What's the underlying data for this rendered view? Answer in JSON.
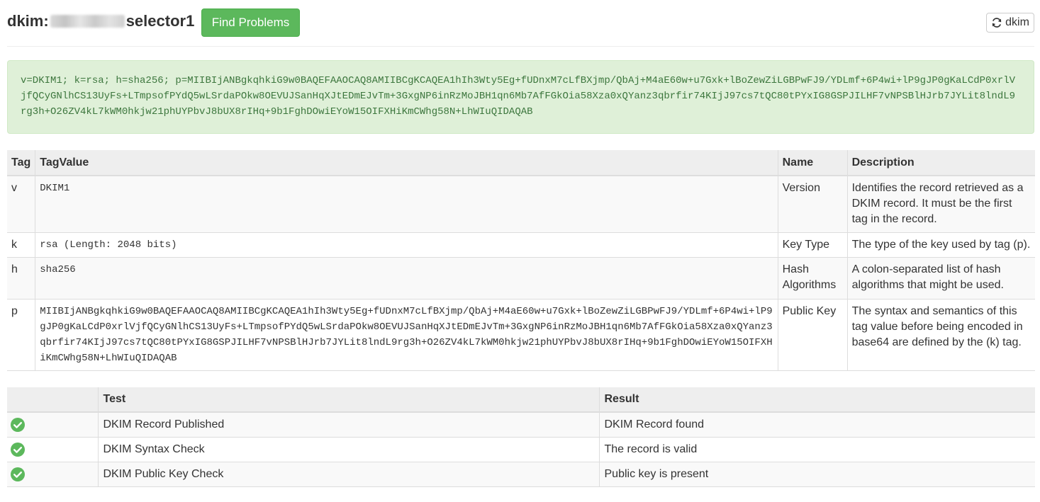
{
  "header": {
    "title_prefix": "dkim:",
    "title_suffix": "selector1",
    "find_button": "Find Problems",
    "refresh_button": "dkim"
  },
  "record": "v=DKIM1; k=rsa; h=sha256; p=MIIBIjANBgkqhkiG9w0BAQEFAAOCAQ8AMIIBCgKCAQEA1hIh3Wty5Eg+fUDnxM7cLfBXjmp/QbAj+M4aE60w+u7Gxk+lBoZewZiLGBPwFJ9/YDLmf+6P4wi+lP9gJP0gKaLCdP0xrlVjfQCyGNlhCS13UyFs+LTmpsofPYdQ5wLSrdaPOkw8OEVUJSanHqXJtEDmEJvTm+3GxgNP6inRzMoJBH1qn6Mb7AfFGkOia58Xza0xQYanz3qbrfir74KIjJ97cs7tQC80tPYxIG8GSPJILHF7vNPSBlHJrb7JYLit8lndL9rg3h+O26ZV4kL7kWM0hkjw21phUYPbvJ8bUX8rIHq+9b1FghDOwiEYoW15OIFXHiKmCWhg58N+LhWIuQIDAQAB",
  "tag_table": {
    "headers": {
      "tag": "Tag",
      "value": "TagValue",
      "name": "Name",
      "description": "Description"
    },
    "rows": [
      {
        "tag": "v",
        "value": "DKIM1",
        "name": "Version",
        "description": "Identifies the record retrieved as a DKIM record. It must be the first tag in the record."
      },
      {
        "tag": "k",
        "value": "rsa (Length: 2048 bits)",
        "name": "Key Type",
        "description": "The type of the key used by tag (p)."
      },
      {
        "tag": "h",
        "value": "sha256",
        "name": "Hash Algorithms",
        "description": "A colon-separated list of hash algorithms that might be used."
      },
      {
        "tag": "p",
        "value": "MIIBIjANBgkqhkiG9w0BAQEFAAOCAQ8AMIIBCgKCAQEA1hIh3Wty5Eg+fUDnxM7cLfBXjmp/QbAj+M4aE60w+u7Gxk+lBoZewZiLGBPwFJ9/YDLmf+6P4wi+lP9gJP0gKaLCdP0xrlVjfQCyGNlhCS13UyFs+LTmpsofPYdQ5wLSrdaPOkw8OEVUJSanHqXJtEDmEJvTm+3GxgNP6inRzMoJBH1qn6Mb7AfFGkOia58Xza0xQYanz3qbrfir74KIjJ97cs7tQC80tPYxIG8GSPJILHF7vNPSBlHJrb7JYLit8lndL9rg3h+O26ZV4kL7kWM0hkjw21phUYPbvJ8bUX8rIHq+9b1FghDOwiEYoW15OIFXHiKmCWhg58N+LhWIuQIDAQAB",
        "name": "Public Key",
        "description": "The syntax and semantics of this tag value before being encoded in base64 are defined by the (k) tag."
      }
    ]
  },
  "test_table": {
    "headers": {
      "status": "",
      "test": "Test",
      "result": "Result"
    },
    "rows": [
      {
        "status_icon": "check-circle-icon",
        "test": "DKIM Record Published",
        "result": "DKIM Record found"
      },
      {
        "status_icon": "check-circle-icon",
        "test": "DKIM Syntax Check",
        "result": "The record is valid"
      },
      {
        "status_icon": "check-circle-icon",
        "test": "DKIM Public Key Check",
        "result": "Public key is present"
      }
    ]
  },
  "colors": {
    "success_button": "#5cb85c",
    "record_background": "#dff0d8",
    "record_text": "#3c763d",
    "check_icon": "#5cb85c"
  }
}
